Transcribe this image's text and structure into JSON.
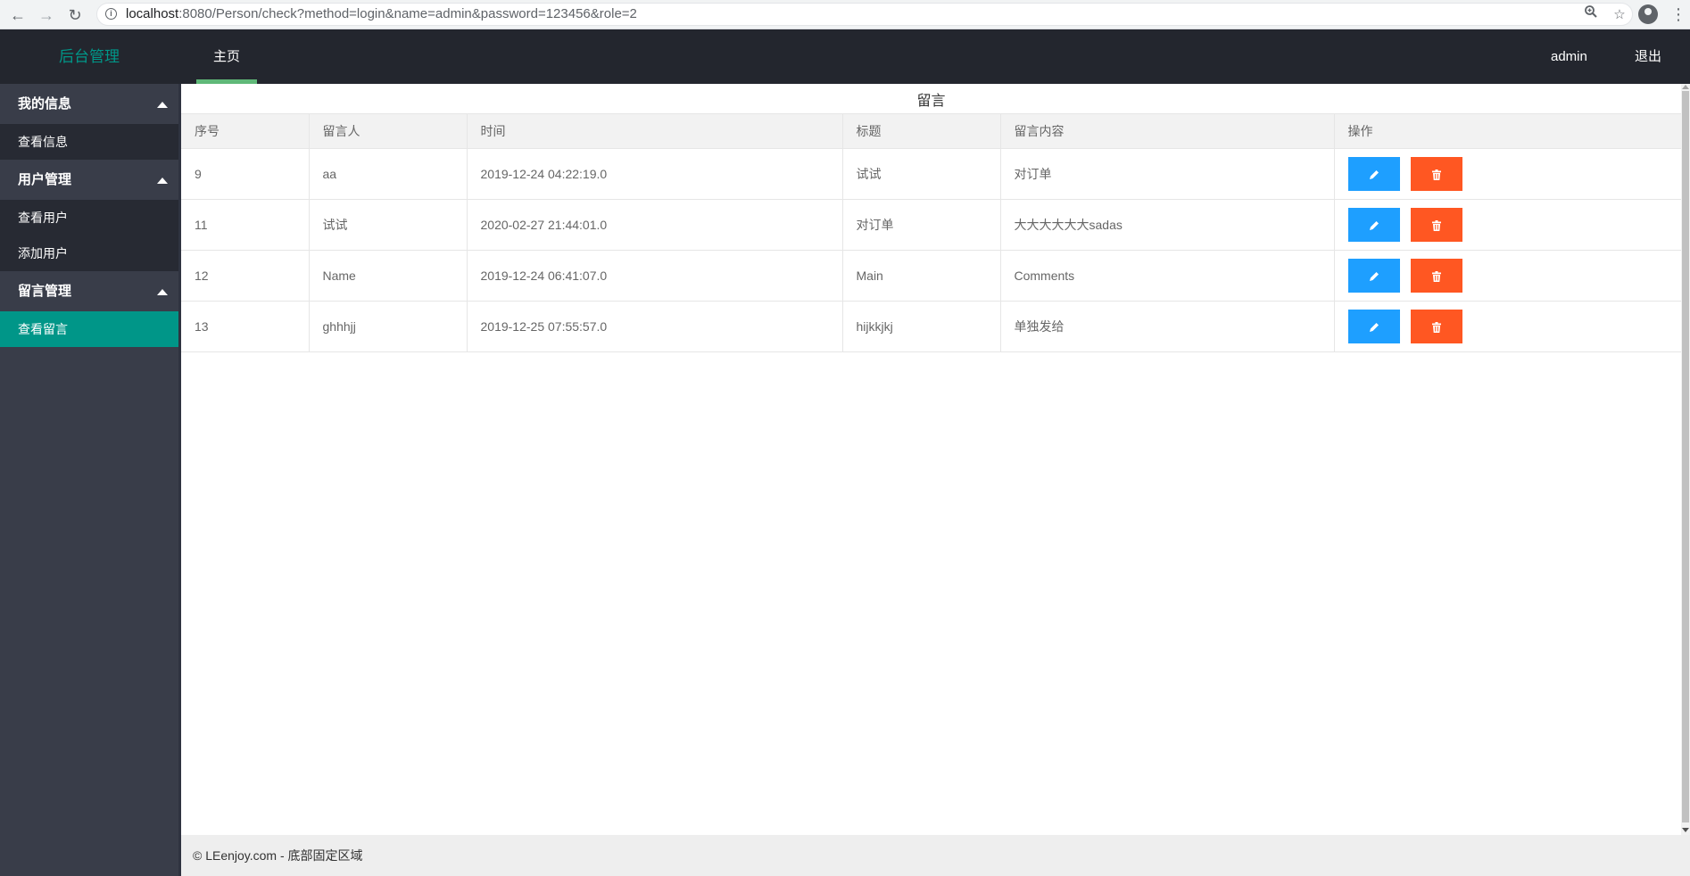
{
  "browser": {
    "url_host": "localhost",
    "url_path": ":8080/Person/check?method=login&name=admin&password=123456&role=2"
  },
  "header": {
    "logo": "后台管理",
    "nav_main": "主页",
    "user": "admin",
    "logout": "退出"
  },
  "sidebar": {
    "groups": [
      {
        "label": "我的信息",
        "items": [
          "查看信息"
        ]
      },
      {
        "label": "用户管理",
        "items": [
          "查看用户",
          "添加用户"
        ]
      },
      {
        "label": "留言管理",
        "items": [
          "查看留言"
        ]
      }
    ],
    "active_item": "查看留言"
  },
  "panel": {
    "title": "留言",
    "columns": [
      "序号",
      "留言人",
      "时间",
      "标题",
      "留言内容",
      "操作"
    ],
    "rows": [
      {
        "id": "9",
        "author": "aa",
        "time": "2019-12-24 04:22:19.0",
        "title": "试试",
        "content": "对订单"
      },
      {
        "id": "11",
        "author": "试试",
        "time": "2020-02-27 21:44:01.0",
        "title": "对订单",
        "content": "大大大大大大sadas"
      },
      {
        "id": "12",
        "author": "Name",
        "time": "2019-12-24 06:41:07.0",
        "title": "Main",
        "content": "Comments"
      },
      {
        "id": "13",
        "author": "ghhhjj",
        "time": "2019-12-25 07:55:57.0",
        "title": "hijkkjkj",
        "content": "单独发给"
      }
    ],
    "actions": {
      "edit_icon": "pencil-icon",
      "delete_icon": "trash-icon"
    }
  },
  "footer": {
    "text": "© LEenjoy.com - 底部固定区域"
  },
  "colors": {
    "header_bg": "#23262e",
    "sidebar_bg": "#393d49",
    "accent": "#009688",
    "edit_btn": "#1e9fff",
    "delete_btn": "#ff5722",
    "nav_bar": "#5fb878"
  }
}
